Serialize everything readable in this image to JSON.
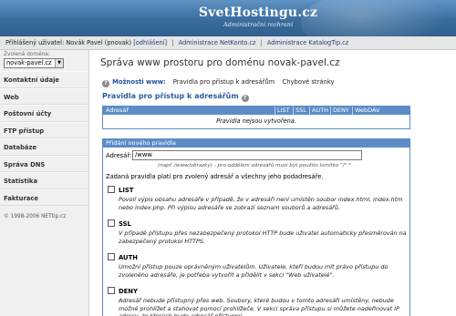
{
  "header": {
    "logo_title": "SvetHostingu.cz",
    "logo_subtitle": "Administrační rozhraní"
  },
  "userbar": {
    "prefix": "Přihlášený uživatel:",
    "user": "Novák Pavel (pnovak)",
    "logout": "[odhlášení]",
    "sep1": "|",
    "admin_netkonto": "Administrace NetKonto.cz",
    "sep2": "|",
    "admin_katalog": "Administrace KatalogTip.cz"
  },
  "sidebar": {
    "domain_label": "Zvolená doména:",
    "domain_value": "novak-pavel.cz",
    "items": [
      {
        "label": "Kontaktní údaje"
      },
      {
        "label": "Web"
      },
      {
        "label": "Poštovní účty"
      },
      {
        "label": "FTP přístup"
      },
      {
        "label": "Databáze"
      },
      {
        "label": "Správa DNS"
      },
      {
        "label": "Statistika"
      },
      {
        "label": "Fakturace"
      }
    ],
    "copyright": "© 1998-2006 NETtip.cz"
  },
  "main": {
    "title": "Správa www prostoru pro doménu novak-pavel.cz",
    "subnav": {
      "label": "Možnosti www:",
      "link1": "Pravidla pro přístup k adresářům",
      "link2": "Chybové stránky"
    },
    "section_title": "Pravidla pro přístup k adresářům",
    "table": {
      "headers": [
        "Adresář",
        "LIST",
        "SSL",
        "AUTH",
        "DENY",
        "WebDAV"
      ],
      "empty_message": "Pravidla nejsou vytvořena."
    },
    "form": {
      "title": "Přidání nového pravidla",
      "address_label": "Adresář:",
      "address_value": "/www",
      "hint": "(např. /www/obrazky) - pro oddělení adresářů musí být použito lomítko \"/\" *",
      "note": "Zadaná pravidla platí pro zvolený adresář a všechny jeho podadresáře.",
      "options": [
        {
          "title": "LIST",
          "desc": "Povolí výpis obsahu adresáře v případě, že v adresáři není umístěn soubor index.html, index.htm nebo index.php. Při výpisu adresáře se zobrazí seznam souborů a adresářů."
        },
        {
          "title": "SSL",
          "desc": "V případě přístupu přes nezabezpečený protokol HTTP bude uživatel automaticky přesměrován na zabezpečený protokol HTTPS."
        },
        {
          "title": "AUTH",
          "desc": "Umožní přístup pouze oprávněným uživatelům. Uživatele, kteří budou mít právo přístupu do zvoleného adresáře, je potřeba vytvořit a přidělit v sekci \"Web uživatelé\"."
        },
        {
          "title": "DENY",
          "desc": "Adresář nebude přístupný přes web. Soubory, které budou v tomto adresáři umístěny, nebude možné prohlížet a stahovat pomocí prohlížeče. V sekci správa přístupu si můžete nadefinovat IP adresy, ze kterých bude adresář přístupný."
        }
      ]
    }
  },
  "colors": {
    "header_bg": "#3a6c9c",
    "table_head": "#5b8cc8",
    "section_title": "#2a5d9a"
  }
}
